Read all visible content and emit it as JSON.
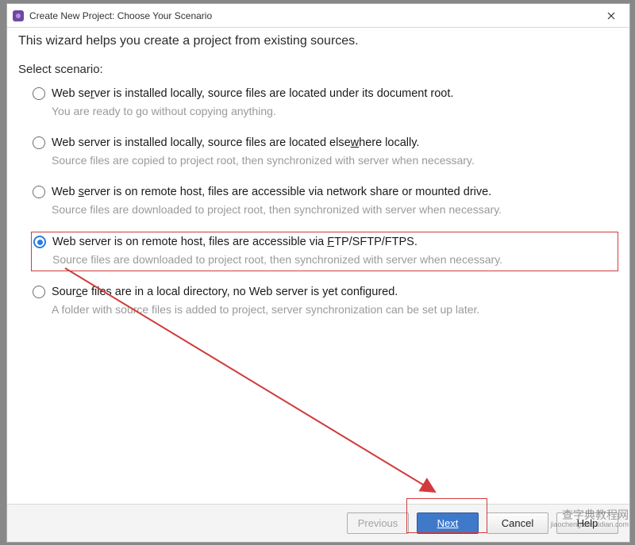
{
  "window": {
    "title": "Create New Project: Choose Your Scenario"
  },
  "intro": "This wizard helps you create a project from existing sources.",
  "selectLabel": "Select scenario:",
  "options": [
    {
      "title": "Web server is installed locally, source files are located under its document root.",
      "titleUnderlineChar": "r",
      "desc": "You are ready to go without copying anything.",
      "selected": false
    },
    {
      "title": "Web server is installed locally, source files are located elsewhere locally.",
      "titleUnderlineChar": "w",
      "desc": "Source files are copied to project root, then synchronized with server when necessary.",
      "selected": false
    },
    {
      "title": "Web server is on remote host, files are accessible via network share or mounted drive.",
      "titleUnderlineChar": "s",
      "desc": "Source files are downloaded to project root, then synchronized with server when necessary.",
      "selected": false
    },
    {
      "title": "Web server is on remote host, files are accessible via FTP/SFTP/FTPS.",
      "titleUnderlineChar": "F",
      "desc": "Source files are downloaded to project root, then synchronized with server when necessary.",
      "selected": true
    },
    {
      "title": "Source files are in a local directory, no Web server is yet configured.",
      "titleUnderlineChar": "c",
      "desc": "A folder with source files is added to project, server synchronization can be set up later.",
      "selected": false
    }
  ],
  "buttons": {
    "previous": "Previous",
    "next": "Next",
    "cancel": "Cancel",
    "help": "Help"
  },
  "watermark": {
    "line1": "查字典教程网",
    "line2": "jiaocheng.chazidian.com"
  },
  "annotations": {
    "highlightedOptionIndex": 3,
    "arrowColor": "#d23b3b"
  }
}
